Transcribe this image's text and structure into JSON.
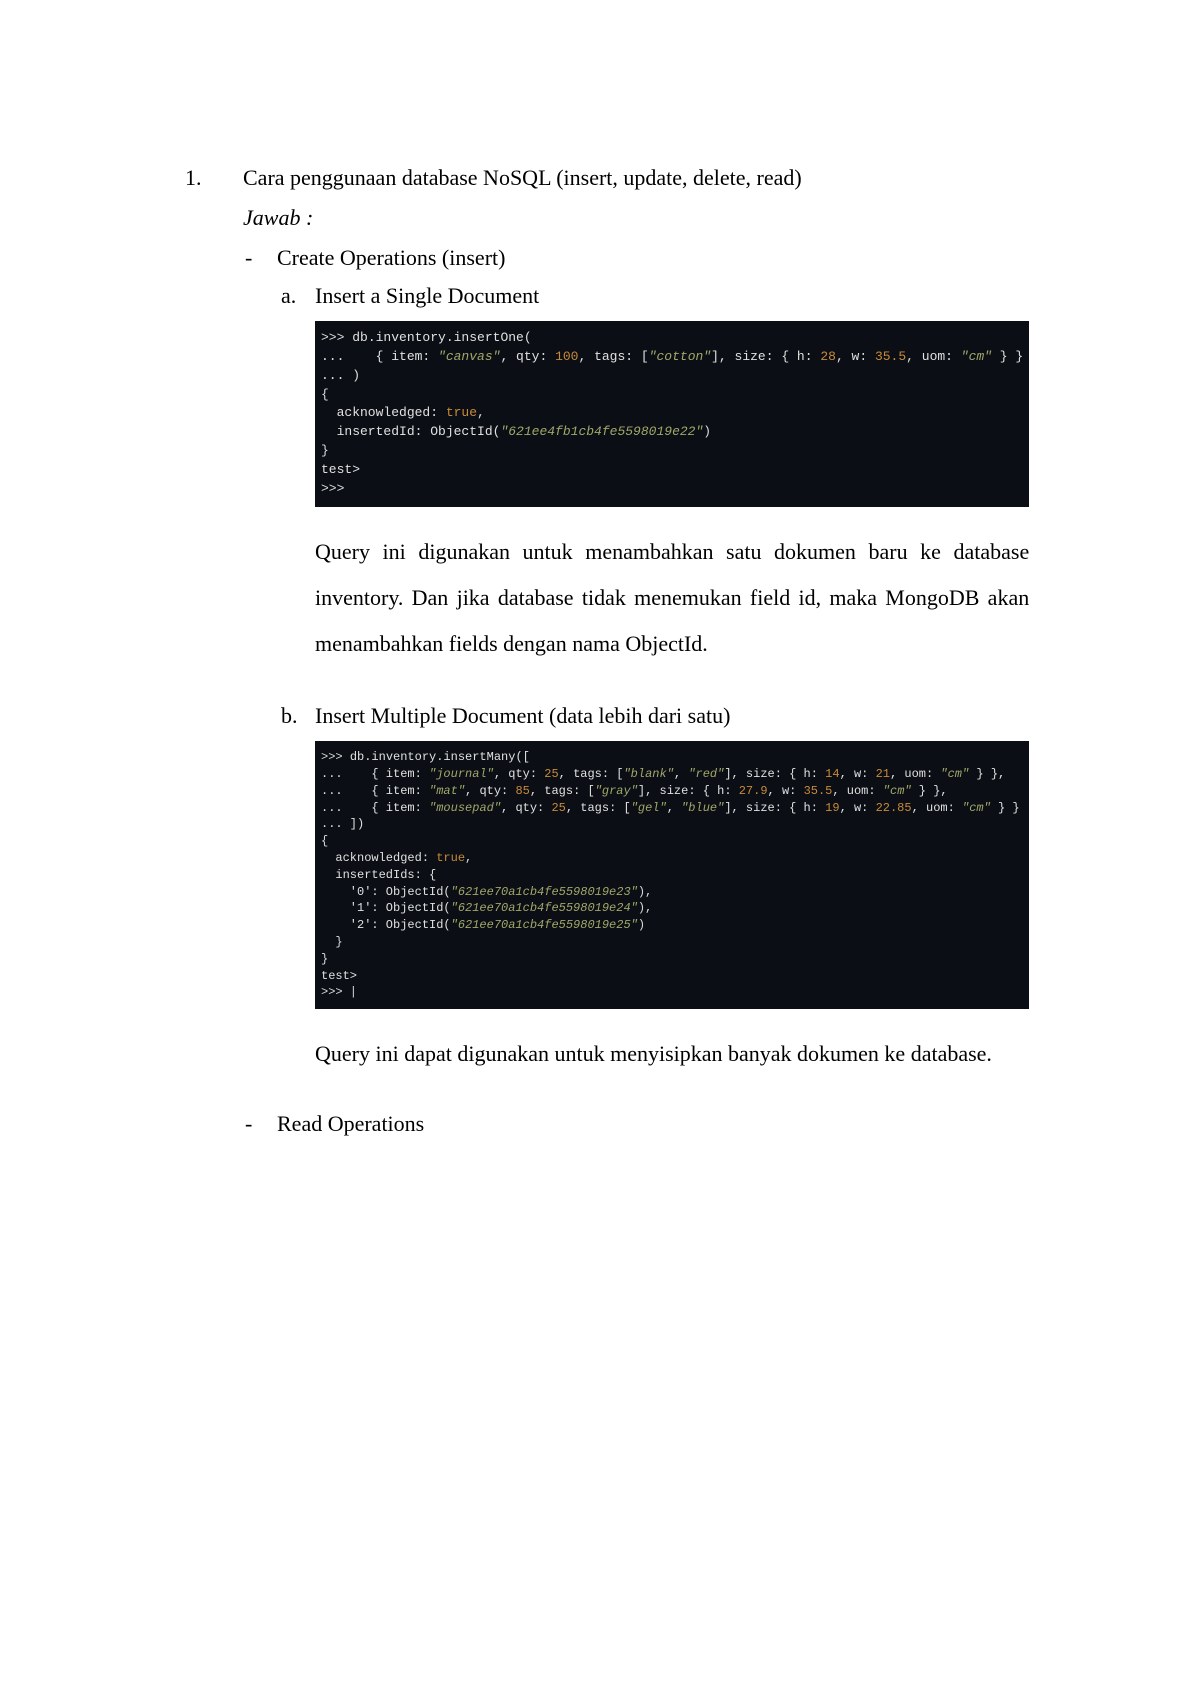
{
  "item": {
    "number": "1.",
    "title": "Cara penggunaan database NoSQL (insert, update, delete, read)",
    "answer_label": "Jawab :"
  },
  "bullets": [
    {
      "heading": "Create Operations (insert)",
      "subs": [
        {
          "letter": "a.",
          "title": "Insert a Single Document",
          "code": {
            "line1_prompt": ">>> ",
            "line1_call": "db.inventory.insertOne(",
            "line2_prefix": "...    { item: ",
            "line2_item": "\"canvas\"",
            "line2_mid1": ", qty: ",
            "line2_qty": "100",
            "line2_mid2": ", tags: [",
            "line2_tag": "\"cotton\"",
            "line2_mid3": "], size: { h: ",
            "line2_h": "28",
            "line2_mid4": ", w: ",
            "line2_w": "35.5",
            "line2_mid5": ", uom: ",
            "line2_uom": "\"cm\"",
            "line2_end": " } }",
            "line3": "... )",
            "line4": "{",
            "line5_pre": "  acknowledged: ",
            "line5_val": "true",
            "line5_post": ",",
            "line6_pre": "  insertedId: ObjectId(",
            "line6_id": "\"621ee4fb1cb4fe5598019e22\"",
            "line6_post": ")",
            "line7": "}",
            "line8": "test>",
            "line9": ">>>"
          },
          "desc": "Query ini digunakan untuk menambahkan satu dokumen baru ke database inventory. Dan jika database tidak menemukan field id, maka MongoDB akan menambahkan fields dengan nama ObjectId."
        },
        {
          "letter": "b.",
          "title": "Insert Multiple Document (data lebih dari satu)",
          "code": {
            "l1_prompt": ">>> ",
            "l1_call": "db.inventory.insertMany([",
            "l2_pre": "...    { item: ",
            "l2_item": "\"journal\"",
            "l2_m1": ", qty: ",
            "l2_qty": "25",
            "l2_m2": ", tags: [",
            "l2_t1": "\"blank\"",
            "l2_m3": ", ",
            "l2_t2": "\"red\"",
            "l2_m4": "], size: { h: ",
            "l2_h": "14",
            "l2_m5": ", w: ",
            "l2_w": "21",
            "l2_m6": ", uom: ",
            "l2_uom": "\"cm\"",
            "l2_end": " } },",
            "l3_pre": "...    { item: ",
            "l3_item": "\"mat\"",
            "l3_m1": ", qty: ",
            "l3_qty": "85",
            "l3_m2": ", tags: [",
            "l3_t1": "\"gray\"",
            "l3_m3": "], size: { h: ",
            "l3_h": "27.9",
            "l3_m4": ", w: ",
            "l3_w": "35.5",
            "l3_m5": ", uom: ",
            "l3_uom": "\"cm\"",
            "l3_end": " } },",
            "l4_pre": "...    { item: ",
            "l4_item": "\"mousepad\"",
            "l4_m1": ", qty: ",
            "l4_qty": "25",
            "l4_m2": ", tags: [",
            "l4_t1": "\"gel\"",
            "l4_m3": ", ",
            "l4_t2": "\"blue\"",
            "l4_m4": "], size: { h: ",
            "l4_h": "19",
            "l4_m5": ", w: ",
            "l4_w": "22.85",
            "l4_m6": ", uom: ",
            "l4_uom": "\"cm\"",
            "l4_end": " } }",
            "l5": "... ])",
            "l6": "{",
            "l7_pre": "  acknowledged: ",
            "l7_val": "true",
            "l7_post": ",",
            "l8": "  insertedIds: {",
            "l9_pre": "    '0': ObjectId(",
            "l9_id": "\"621ee70a1cb4fe5598019e23\"",
            "l9_post": "),",
            "l10_pre": "    '1': ObjectId(",
            "l10_id": "\"621ee70a1cb4fe5598019e24\"",
            "l10_post": "),",
            "l11_pre": "    '2': ObjectId(",
            "l11_id": "\"621ee70a1cb4fe5598019e25\"",
            "l11_post": ")",
            "l12": "  }",
            "l13": "}",
            "l14": "test>",
            "l15": ">>> |"
          },
          "desc": "Query ini dapat digunakan untuk menyisipkan banyak dokumen ke database."
        }
      ]
    },
    {
      "heading": "Read Operations"
    }
  ]
}
